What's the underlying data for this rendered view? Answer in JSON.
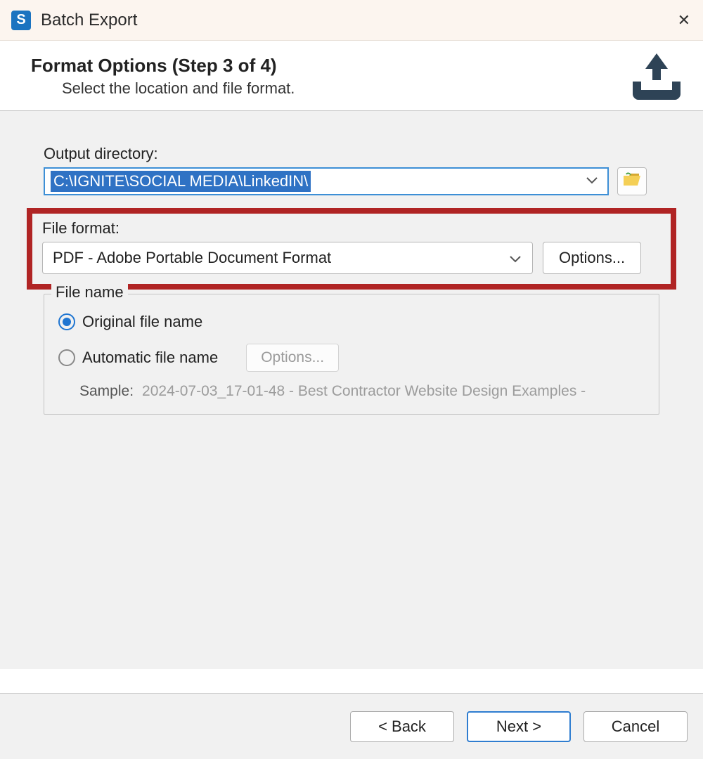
{
  "window": {
    "title": "Batch Export",
    "app_icon_letter": "S"
  },
  "header": {
    "title": "Format Options (Step 3 of 4)",
    "subtitle": "Select the location and file format."
  },
  "outdir": {
    "label": "Output directory:",
    "value": "C:\\IGNITE\\SOCIAL MEDIA\\LinkedIN\\"
  },
  "format": {
    "label": "File format:",
    "selected": "PDF - Adobe Portable Document Format",
    "options_button": "Options..."
  },
  "filename": {
    "legend": "File name",
    "radio_original": "Original file name",
    "radio_automatic": "Automatic file name",
    "options_button": "Options...",
    "sample_label": "Sample:",
    "sample_text": "2024-07-03_17-01-48 - Best Contractor Website Design Examples -"
  },
  "footer": {
    "back": "< Back",
    "next": "Next >",
    "cancel": "Cancel"
  }
}
